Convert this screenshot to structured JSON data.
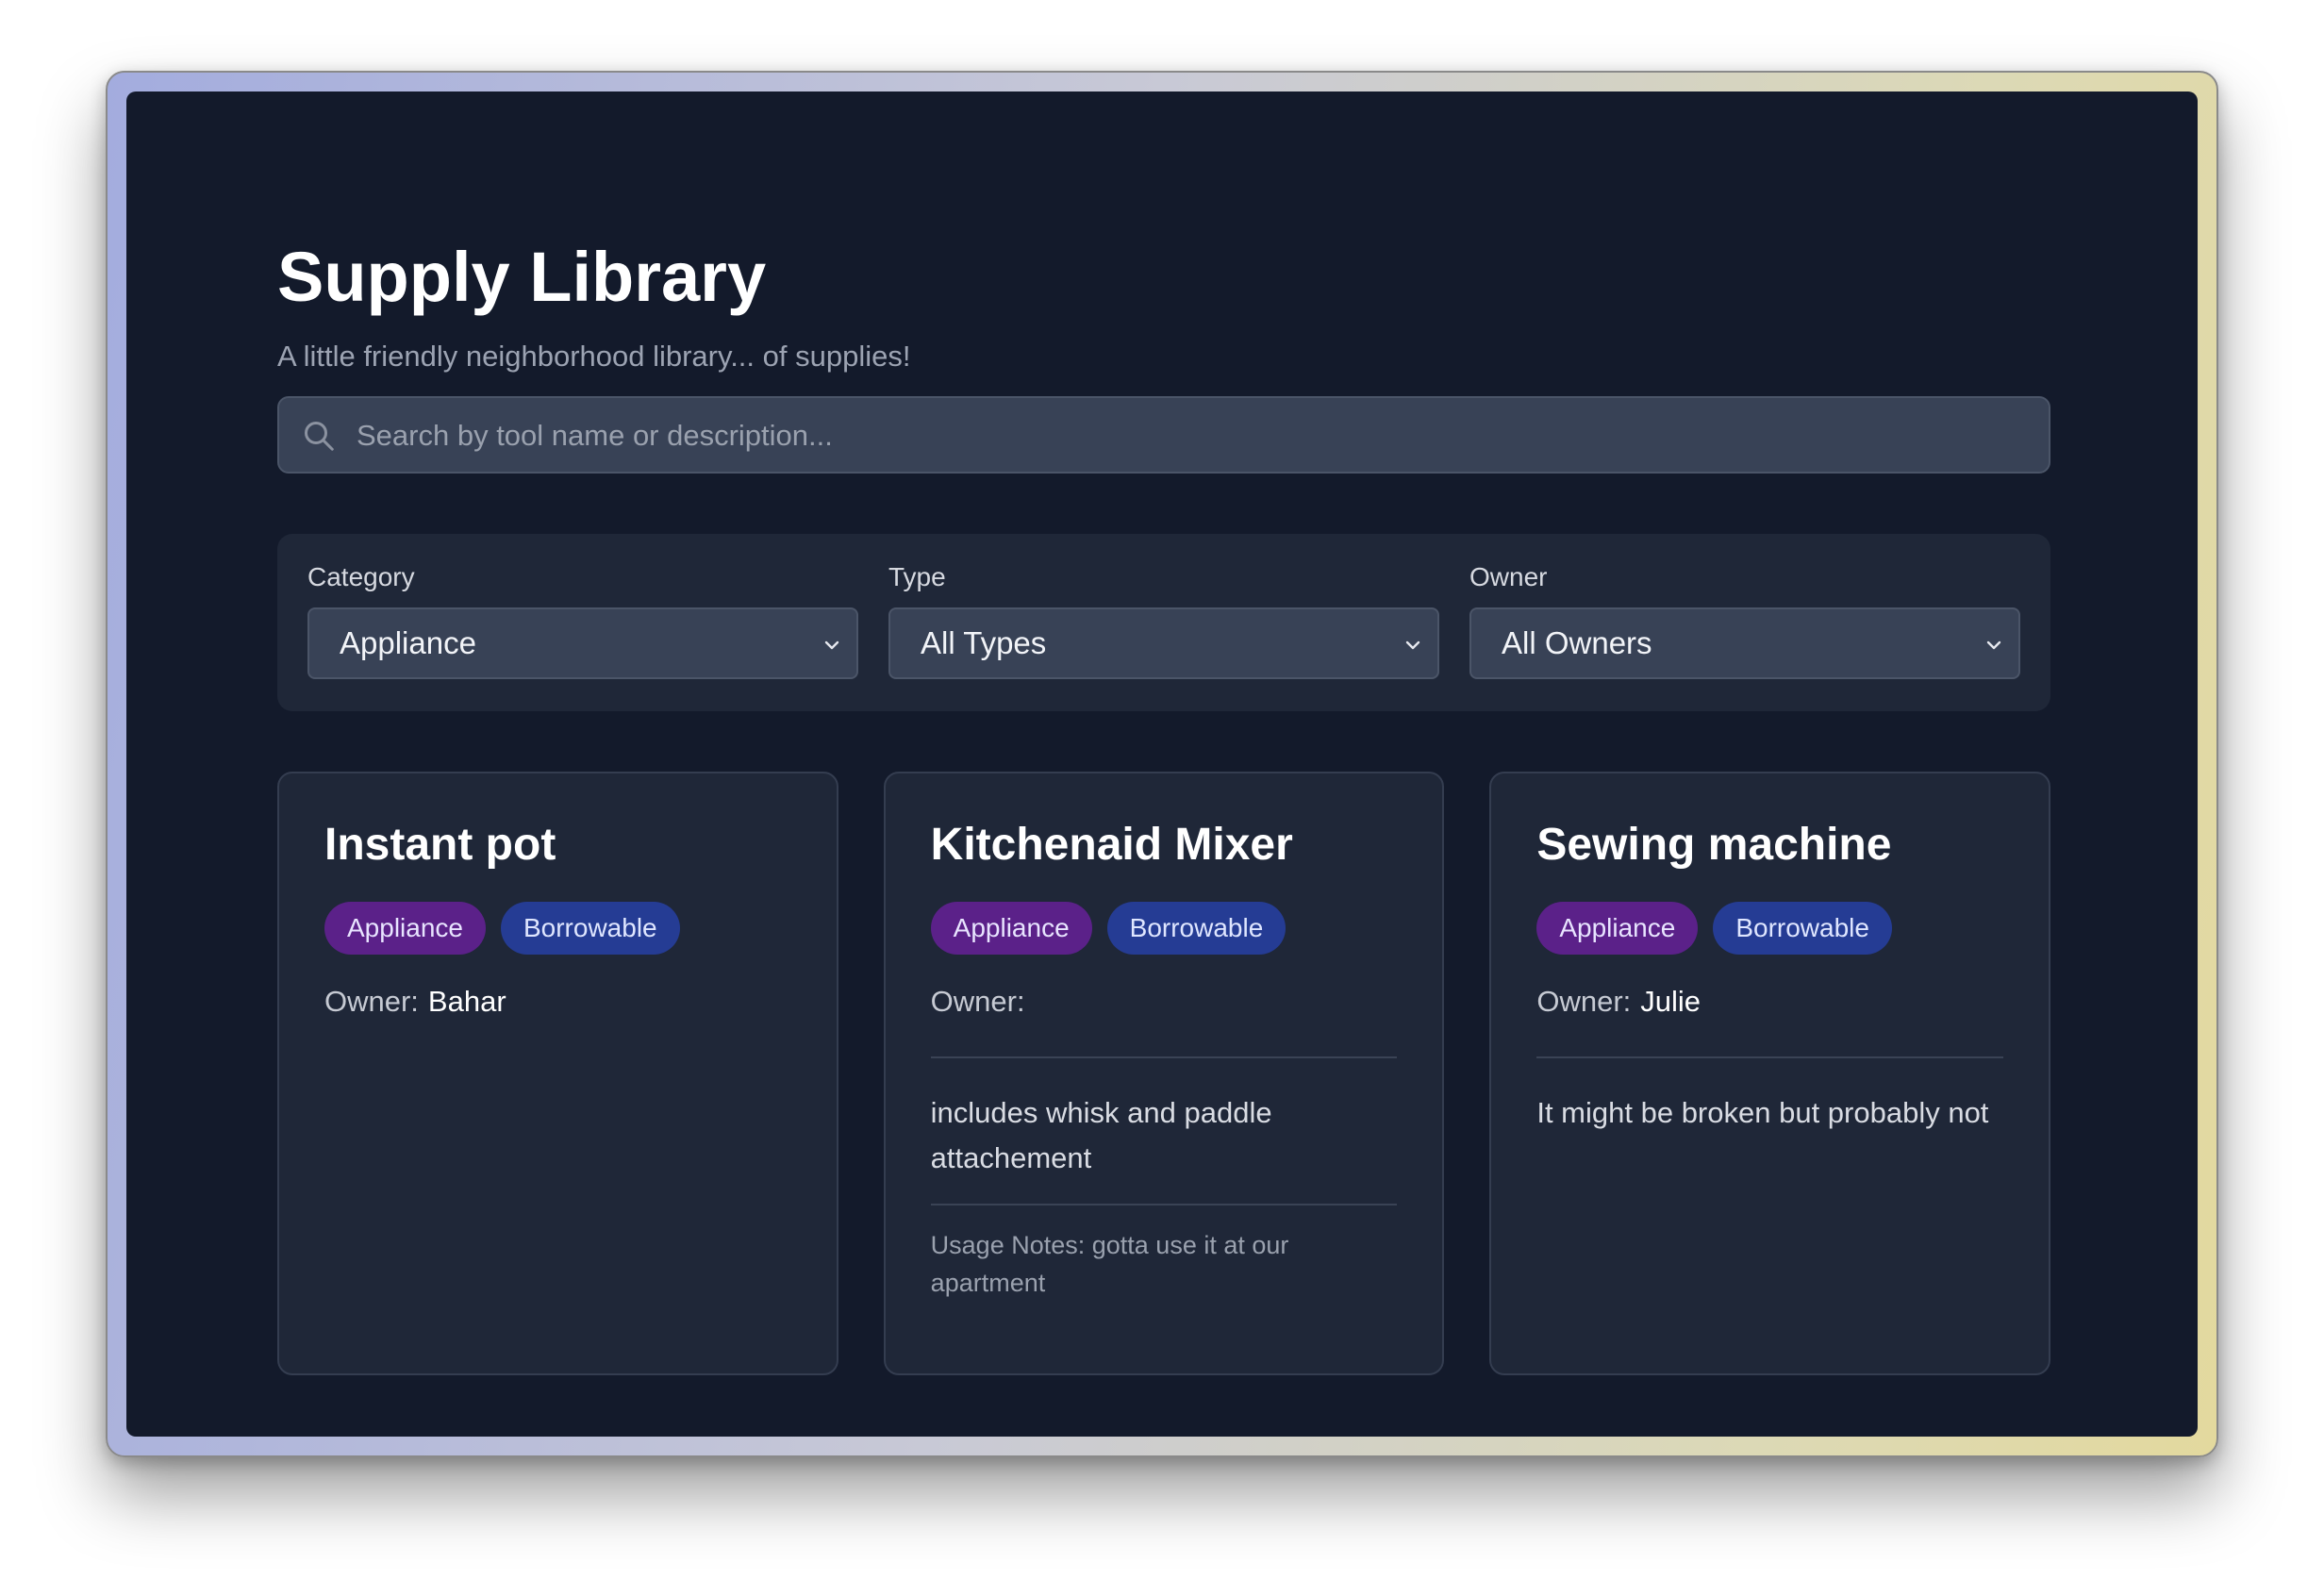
{
  "header": {
    "title": "Supply Library",
    "subtitle": "A little friendly neighborhood library... of supplies!"
  },
  "search": {
    "placeholder": "Search by tool name or description...",
    "value": "",
    "icon": "search-icon"
  },
  "filters": [
    {
      "label": "Category",
      "value": "Appliance"
    },
    {
      "label": "Type",
      "value": "All Types"
    },
    {
      "label": "Owner",
      "value": "All Owners"
    }
  ],
  "owner_label": "Owner:",
  "cards": [
    {
      "title": "Instant pot",
      "category": "Appliance",
      "type": "Borrowable",
      "owner": "Bahar",
      "description": "",
      "usage_notes": ""
    },
    {
      "title": "Kitchenaid Mixer",
      "category": "Appliance",
      "type": "Borrowable",
      "owner": "",
      "description": "includes whisk and paddle attachement",
      "usage_notes": "Usage Notes: gotta use it at our apartment"
    },
    {
      "title": "Sewing machine",
      "category": "Appliance",
      "type": "Borrowable",
      "owner": "Julie",
      "description": "It might be broken but probably not",
      "usage_notes": ""
    }
  ],
  "colors": {
    "background": "#131a2b",
    "panel": "#1f2738",
    "input": "#384256",
    "category_tag": "#5b2189",
    "type_tag": "#253c94"
  }
}
